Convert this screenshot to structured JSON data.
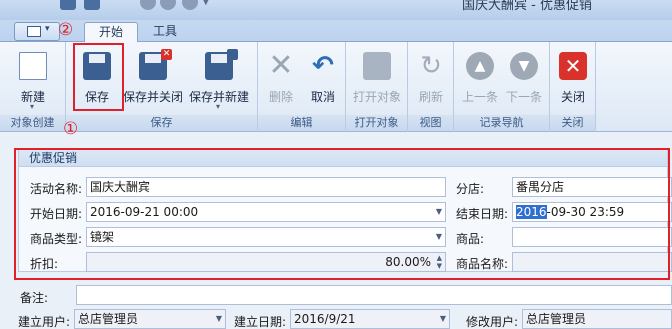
{
  "title_bar": {
    "title": "国庆大酬宾 - 优惠促销"
  },
  "tabs": [
    {
      "label": "开始",
      "active": true
    },
    {
      "label": "工具",
      "active": false
    }
  ],
  "ribbon": {
    "groups": [
      {
        "label": "对象创建",
        "buttons": [
          {
            "label": "新建",
            "icon": "new-document-icon",
            "enabled": true
          }
        ]
      },
      {
        "label": "保存",
        "buttons": [
          {
            "label": "保存",
            "icon": "save-icon",
            "enabled": true
          },
          {
            "label": "保存并关闭",
            "icon": "save-close-icon",
            "enabled": true
          },
          {
            "label": "保存并新建",
            "icon": "save-new-icon",
            "enabled": true
          }
        ]
      },
      {
        "label": "编辑",
        "buttons": [
          {
            "label": "删除",
            "icon": "delete-icon",
            "enabled": false
          },
          {
            "label": "取消",
            "icon": "undo-icon",
            "enabled": true
          }
        ]
      },
      {
        "label": "打开对象",
        "buttons": [
          {
            "label": "打开对象",
            "icon": "open-object-icon",
            "enabled": false
          }
        ]
      },
      {
        "label": "视图",
        "buttons": [
          {
            "label": "刷新",
            "icon": "refresh-icon",
            "enabled": false
          }
        ]
      },
      {
        "label": "记录导航",
        "buttons": [
          {
            "label": "上一条",
            "icon": "arrow-up-icon",
            "enabled": false
          },
          {
            "label": "下一条",
            "icon": "arrow-down-icon",
            "enabled": false
          }
        ]
      },
      {
        "label": "关闭",
        "buttons": [
          {
            "label": "关闭",
            "icon": "close-icon",
            "enabled": true
          }
        ]
      }
    ]
  },
  "annotations": {
    "one": "①",
    "two": "②"
  },
  "form": {
    "section_title": "优惠促销",
    "fields": {
      "activity_name": {
        "label": "活动名称:",
        "value": "国庆大酬宾"
      },
      "branch": {
        "label": "分店:",
        "value": "番禺分店"
      },
      "start_date": {
        "label": "开始日期:",
        "value": "2016-09-21 00:00"
      },
      "end_date": {
        "label": "结束日期:",
        "value_selected": "2016",
        "value_rest": "-09-30 23:59"
      },
      "product_type": {
        "label": "商品类型:",
        "value": "镜架"
      },
      "product": {
        "label": "商品:",
        "value": ""
      },
      "discount": {
        "label": "折扣:",
        "value": "80.00%"
      },
      "product_name": {
        "label": "商品名称:",
        "value": ""
      },
      "remarks": {
        "label": "备注:",
        "value": ""
      },
      "created_by": {
        "label": "建立用户:",
        "value": "总店管理员"
      },
      "created_date": {
        "label": "建立日期:",
        "value": "2016/9/21"
      },
      "modified_by": {
        "label": "修改用户:",
        "value": "总店管理员"
      }
    }
  },
  "colors": {
    "highlight": "#e0212b",
    "ribbon_bg": "#dde8f5",
    "selection": "#2f6fd1"
  }
}
